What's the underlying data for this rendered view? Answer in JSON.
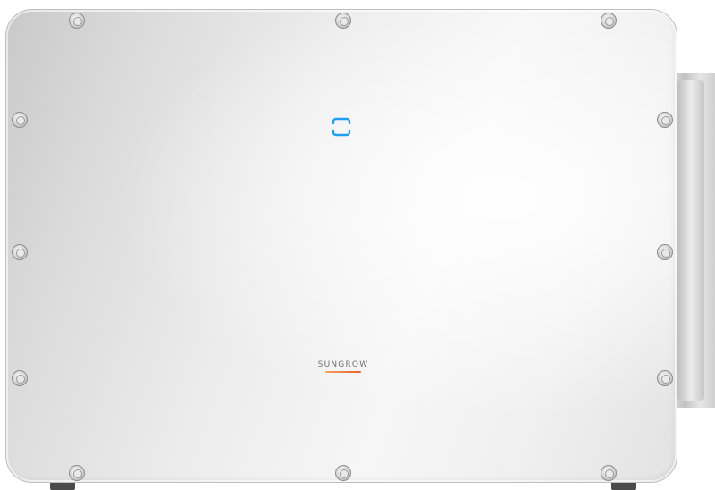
{
  "device": {
    "brand": "SUNGROW",
    "indicator_icon": "rounded-square-led-icon",
    "indicator_color": "#1e9ef0",
    "brand_accent_color": "#e5622a",
    "body_color": "#e6e6e6"
  }
}
